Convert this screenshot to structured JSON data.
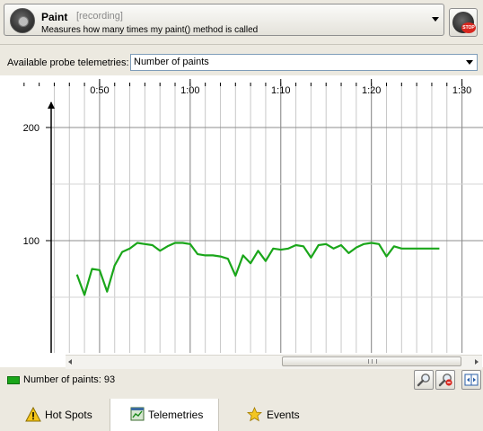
{
  "probe": {
    "name": "Paint",
    "status": "[recording]",
    "description": "Measures how many times my paint() method is called"
  },
  "record_button": {
    "badge": "STOP"
  },
  "telemetry": {
    "label": "Available probe telemetries:",
    "selected": "Number of paints"
  },
  "chart_data": {
    "type": "line",
    "title": "",
    "xlabel": "",
    "ylabel": "",
    "x_tick_labels": [
      "0:50",
      "1:00",
      "1:10",
      "1:20",
      "1:30"
    ],
    "y_tick_labels": [
      "100",
      "200"
    ],
    "ylim": [
      0,
      235
    ],
    "grid": true,
    "series": [
      {
        "name": "Number of paints",
        "color": "#1aa61a",
        "t_seconds": [
          2685,
          2690,
          2695,
          2700,
          2705,
          2710,
          2715,
          2720,
          2725,
          2730,
          2735,
          2740,
          2745,
          2750,
          2755,
          2760,
          2765,
          2770,
          2775,
          2780,
          2785,
          2790,
          2795,
          2800,
          2805,
          2810,
          2815,
          2820,
          2825,
          2830,
          2835,
          2840,
          2845,
          2850,
          2855,
          2860,
          2865,
          2870,
          2875,
          2880,
          2885,
          2890,
          2895,
          2900,
          2905,
          2910,
          2915,
          2920,
          2925
        ],
        "values": [
          70,
          52,
          75,
          74,
          55,
          78,
          90,
          93,
          98,
          97,
          96,
          91,
          95,
          98,
          98,
          97,
          88,
          87,
          87,
          86,
          84,
          69,
          87,
          80,
          91,
          82,
          93,
          92,
          93,
          96,
          95,
          85,
          96,
          97,
          93,
          96,
          89,
          94,
          97,
          98,
          97,
          86,
          95,
          93,
          93,
          93,
          93,
          93,
          93
        ]
      }
    ]
  },
  "legend": {
    "label": "Number of paints: 93"
  },
  "tabs": [
    {
      "label": "Hot Spots",
      "icon": "warning-icon"
    },
    {
      "label": "Telemetries",
      "icon": "telemetry-icon"
    },
    {
      "label": "Events",
      "icon": "star-icon"
    }
  ]
}
